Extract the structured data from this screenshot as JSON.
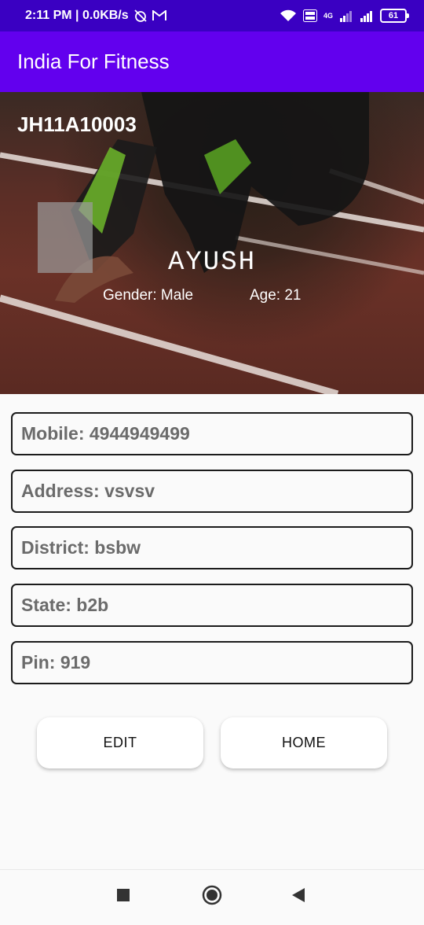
{
  "status_bar": {
    "time_speed": "2:11 PM | 0.0KB/s",
    "network": "4G",
    "battery": "61"
  },
  "app": {
    "title": "India For Fitness"
  },
  "profile": {
    "id": "JH11A10003",
    "name": "AYUSH",
    "gender": "Gender: Male",
    "age": "Age: 21"
  },
  "fields": [
    {
      "text": "Mobile: 4944949499"
    },
    {
      "text": "Address: vsvsv"
    },
    {
      "text": "District: bsbw"
    },
    {
      "text": "State: b2b"
    },
    {
      "text": "Pin: 919"
    }
  ],
  "buttons": {
    "edit": "EDIT",
    "home": "HOME"
  },
  "colors": {
    "app_bar": "#6200ee",
    "status_bar": "#3a00c2",
    "track": "#6a3127"
  }
}
